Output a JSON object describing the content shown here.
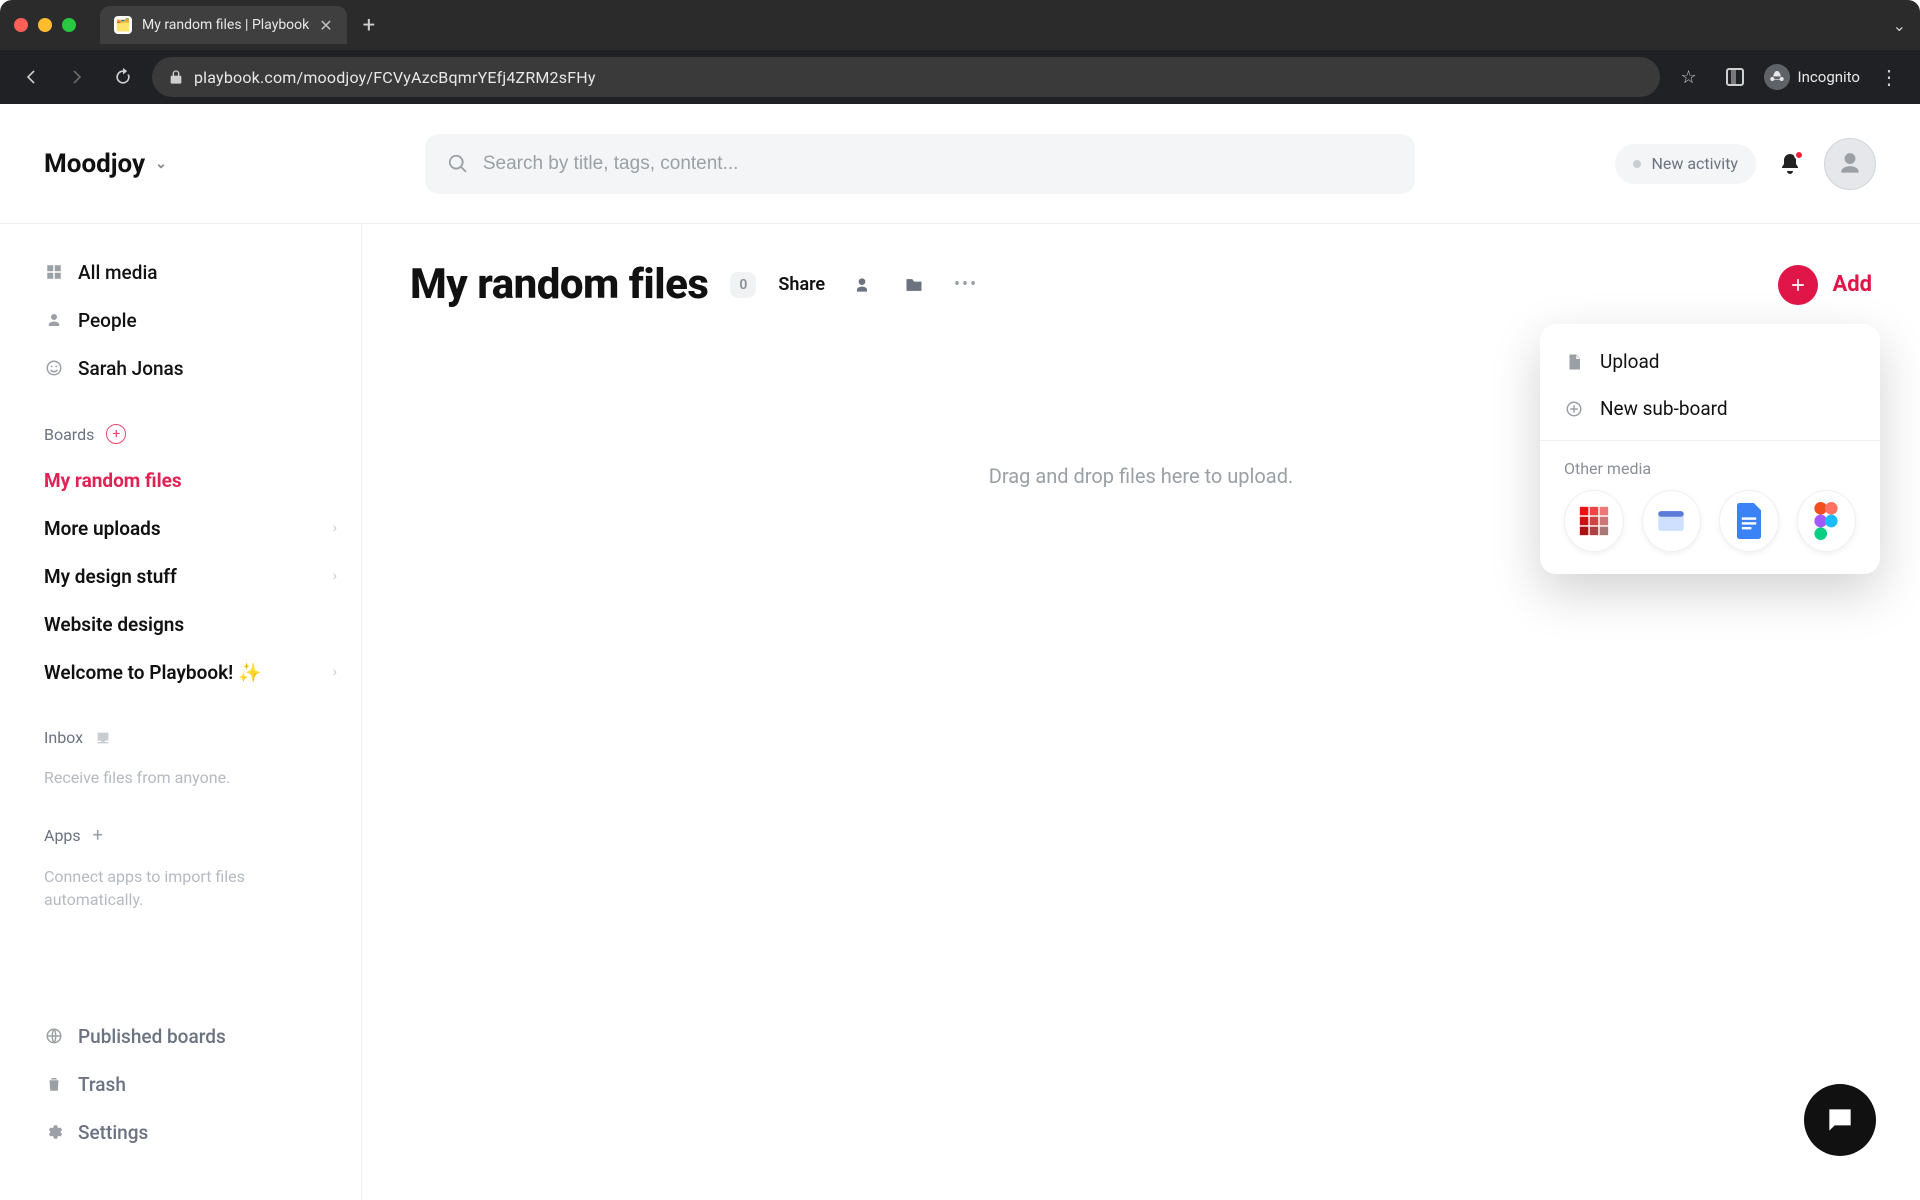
{
  "browser": {
    "tab_title": "My random files | Playbook",
    "url": "playbook.com/moodjoy/FCVyAzcBqmrYEfj4ZRM2sFHy",
    "incognito_label": "Incognito"
  },
  "topbar": {
    "workspace_name": "Moodjoy",
    "search_placeholder": "Search by title, tags, content...",
    "activity_label": "New activity"
  },
  "sidebar": {
    "links": {
      "all_media": "All media",
      "people": "People",
      "user_name": "Sarah Jonas"
    },
    "boards_header": "Boards",
    "boards": [
      {
        "label": "My random files",
        "active": true,
        "has_children": false
      },
      {
        "label": "More uploads",
        "active": false,
        "has_children": true
      },
      {
        "label": "My design stuff",
        "active": false,
        "has_children": true
      },
      {
        "label": "Website designs",
        "active": false,
        "has_children": false
      },
      {
        "label": "Welcome to Playbook! ✨",
        "active": false,
        "has_children": true
      }
    ],
    "inbox_header": "Inbox",
    "inbox_sub": "Receive files from anyone.",
    "apps_header": "Apps",
    "apps_sub": "Connect apps to import files automatically.",
    "bottom": {
      "published": "Published boards",
      "trash": "Trash",
      "settings": "Settings"
    }
  },
  "main": {
    "title": "My random files",
    "count": "0",
    "share_label": "Share",
    "add_label": "Add",
    "dropzone_text": "Drag and drop files here to upload."
  },
  "add_menu": {
    "upload": "Upload",
    "new_sub_board": "New sub-board",
    "other_media_label": "Other media"
  },
  "colors": {
    "accent": "#e11648"
  }
}
